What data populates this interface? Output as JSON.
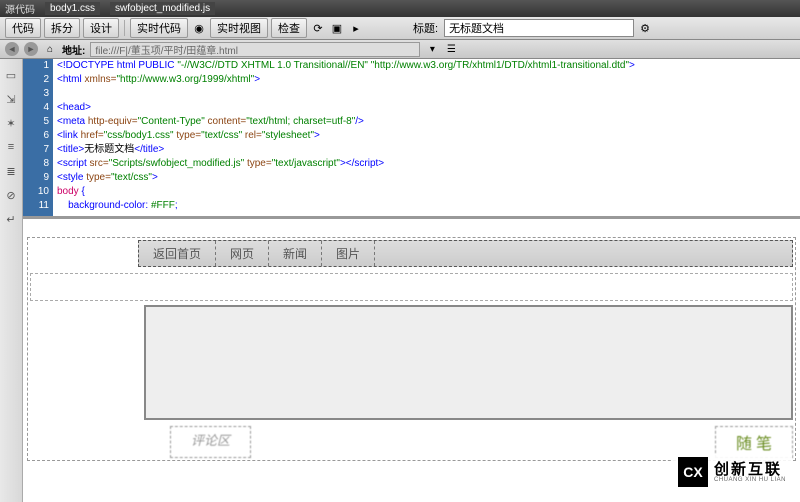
{
  "titlebar": {
    "label": "源代码",
    "tabs": [
      "body1.css",
      "swfobject_modified.js"
    ]
  },
  "toolbar": {
    "buttons": {
      "code": "代码",
      "split": "拆分",
      "design": "设计",
      "live_code": "实时代码",
      "live_view": "实时视图",
      "inspect": "检查"
    },
    "title_label": "标题:",
    "title_value": "无标题文档"
  },
  "addressbar": {
    "label": "地址:",
    "value": "file:///F|/董玉项/平时/田蕴章.html"
  },
  "code": {
    "lines": [
      {
        "n": 1,
        "html": "<span class='c-blue'>&lt;!DOCTYPE html PUBLIC </span><span class='c-green'>\"-//W3C//DTD XHTML 1.0 Transitional//EN\" \"http://www.w3.org/TR/xhtml1/DTD/xhtml1-transitional.dtd\"</span><span class='c-blue'>&gt;</span>"
      },
      {
        "n": 2,
        "html": "<span class='c-blue'>&lt;html </span><span class='c-brown'>xmlns=</span><span class='c-green'>\"http://www.w3.org/1999/xhtml\"</span><span class='c-blue'>&gt;</span>"
      },
      {
        "n": 3,
        "html": ""
      },
      {
        "n": 4,
        "html": "<span class='c-blue'>&lt;head&gt;</span>"
      },
      {
        "n": 5,
        "html": "<span class='c-blue'>&lt;meta </span><span class='c-brown'>http-equiv=</span><span class='c-green'>\"Content-Type\"</span><span class='c-brown'> content=</span><span class='c-green'>\"text/html; charset=utf-8\"</span><span class='c-blue'>/&gt;</span>"
      },
      {
        "n": 6,
        "html": "<span class='c-blue'>&lt;link </span><span class='c-brown'>href=</span><span class='c-green'>\"css/body1.css\"</span><span class='c-brown'> type=</span><span class='c-green'>\"text/css\"</span><span class='c-brown'> rel=</span><span class='c-green'>\"stylesheet\"</span><span class='c-blue'>&gt;</span>"
      },
      {
        "n": 7,
        "html": "<span class='c-blue'>&lt;title&gt;</span><span class='c-black'>无标题文档</span><span class='c-blue'>&lt;/title&gt;</span>"
      },
      {
        "n": 8,
        "html": "<span class='c-blue'>&lt;script </span><span class='c-brown'>src=</span><span class='c-green'>\"Scripts/swfobject_modified.js\"</span><span class='c-brown'> type=</span><span class='c-green'>\"text/javascript\"</span><span class='c-blue'>&gt;</span><span class='c-blue'>&lt;/script&gt;</span>"
      },
      {
        "n": 9,
        "html": "<span class='c-blue'>&lt;style </span><span class='c-brown'>type=</span><span class='c-green'>\"text/css\"</span><span class='c-blue'>&gt;</span>"
      },
      {
        "n": 10,
        "html": "<span class='c-red'>body</span><span class='c-blue'> {</span>"
      },
      {
        "n": 11,
        "html": "    <span class='c-blue'>background-color: </span><span class='c-green'>#FFF</span><span class='c-blue'>;</span>"
      }
    ]
  },
  "design": {
    "nav": [
      "返回首页",
      "网页",
      "新闻",
      "图片"
    ],
    "footer_left": "评论区",
    "footer_right": "随 笔"
  },
  "watermark": {
    "logo": "CX",
    "cn": "创新互联",
    "en": "CHUANG XIN HU LIAN"
  }
}
